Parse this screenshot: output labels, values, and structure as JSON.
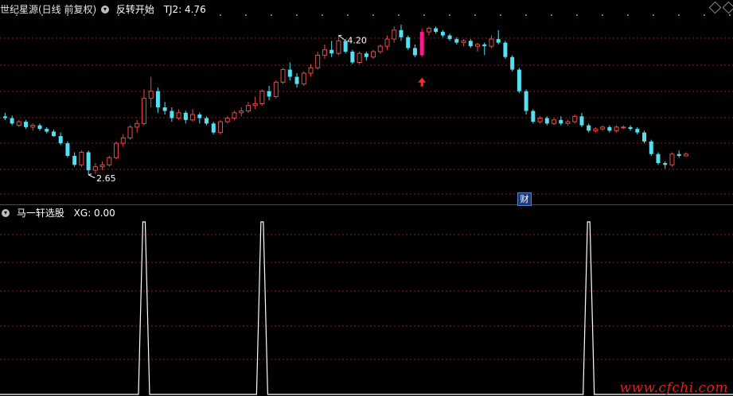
{
  "top_panel": {
    "ticker_label": "世纪星源(日线 前复权)",
    "indicator_name": "反转开始",
    "tj_label": "TJ2: 4.76",
    "high_label": "4.20",
    "low_label": "2.65",
    "finance_badge": "财"
  },
  "bottom_panel": {
    "indicator_name": "马一轩选股",
    "xg_label": "XG: 0.00"
  },
  "watermark": "www.cfchi.com",
  "colors": {
    "background": "#000000",
    "up_candle": "#e84848",
    "down_candle": "#54e0f0",
    "signal_candle": "#ff1a8c",
    "signal_arrow": "#ff2a2a",
    "grid_dash": "#8a1f1f",
    "panel_divider": "#b02020",
    "dots": "#c040d0",
    "xg_line": "#ffffff"
  },
  "chart_data": [
    {
      "type": "candlestick",
      "title": "世纪星源(日线 前复权)",
      "ylim": [
        2.4,
        4.4
      ],
      "candles": [
        [
          3.3,
          3.34,
          3.26,
          3.28
        ],
        [
          3.28,
          3.31,
          3.2,
          3.22
        ],
        [
          3.2,
          3.26,
          3.18,
          3.24
        ],
        [
          3.24,
          3.26,
          3.16,
          3.18
        ],
        [
          3.18,
          3.22,
          3.14,
          3.2
        ],
        [
          3.2,
          3.22,
          3.14,
          3.16
        ],
        [
          3.16,
          3.18,
          3.11,
          3.13
        ],
        [
          3.13,
          3.15,
          3.07,
          3.08
        ],
        [
          3.08,
          3.12,
          2.98,
          3.0
        ],
        [
          3.0,
          3.02,
          2.84,
          2.86
        ],
        [
          2.86,
          2.9,
          2.74,
          2.76
        ],
        [
          2.76,
          2.92,
          2.74,
          2.9
        ],
        [
          2.9,
          2.92,
          2.65,
          2.7
        ],
        [
          2.7,
          2.78,
          2.66,
          2.74
        ],
        [
          2.74,
          2.8,
          2.7,
          2.76
        ],
        [
          2.76,
          2.86,
          2.74,
          2.84
        ],
        [
          2.84,
          3.02,
          2.82,
          3.0
        ],
        [
          3.0,
          3.1,
          2.96,
          3.06
        ],
        [
          3.06,
          3.2,
          3.04,
          3.18
        ],
        [
          3.18,
          3.26,
          3.12,
          3.22
        ],
        [
          3.22,
          3.6,
          3.2,
          3.5
        ],
        [
          3.5,
          3.74,
          3.4,
          3.58
        ],
        [
          3.58,
          3.62,
          3.34,
          3.4
        ],
        [
          3.4,
          3.46,
          3.32,
          3.36
        ],
        [
          3.36,
          3.4,
          3.24,
          3.28
        ],
        [
          3.28,
          3.38,
          3.26,
          3.34
        ],
        [
          3.34,
          3.36,
          3.22,
          3.26
        ],
        [
          3.26,
          3.38,
          3.24,
          3.32
        ],
        [
          3.32,
          3.34,
          3.22,
          3.28
        ],
        [
          3.28,
          3.3,
          3.2,
          3.22
        ],
        [
          3.22,
          3.24,
          3.1,
          3.12
        ],
        [
          3.12,
          3.26,
          3.1,
          3.24
        ],
        [
          3.24,
          3.3,
          3.22,
          3.28
        ],
        [
          3.28,
          3.36,
          3.26,
          3.34
        ],
        [
          3.34,
          3.4,
          3.3,
          3.36
        ],
        [
          3.36,
          3.46,
          3.34,
          3.42
        ],
        [
          3.42,
          3.52,
          3.38,
          3.44
        ],
        [
          3.44,
          3.6,
          3.42,
          3.58
        ],
        [
          3.58,
          3.64,
          3.48,
          3.52
        ],
        [
          3.52,
          3.7,
          3.5,
          3.68
        ],
        [
          3.68,
          3.84,
          3.66,
          3.82
        ],
        [
          3.82,
          3.9,
          3.7,
          3.74
        ],
        [
          3.74,
          3.78,
          3.62,
          3.66
        ],
        [
          3.66,
          3.8,
          3.64,
          3.78
        ],
        [
          3.78,
          3.88,
          3.74,
          3.84
        ],
        [
          3.84,
          4.02,
          3.82,
          3.98
        ],
        [
          3.98,
          4.1,
          3.94,
          4.04
        ],
        [
          4.04,
          4.14,
          3.96,
          4.0
        ],
        [
          4.0,
          4.2,
          3.98,
          4.14
        ],
        [
          4.14,
          4.16,
          4.0,
          4.02
        ],
        [
          4.02,
          4.04,
          3.88,
          3.9
        ],
        [
          3.9,
          4.02,
          3.88,
          4.0
        ],
        [
          4.0,
          4.02,
          3.92,
          3.96
        ],
        [
          3.96,
          4.04,
          3.94,
          4.02
        ],
        [
          4.02,
          4.1,
          4.0,
          4.08
        ],
        [
          4.08,
          4.2,
          4.04,
          4.16
        ],
        [
          4.16,
          4.3,
          4.12,
          4.26
        ],
        [
          4.26,
          4.32,
          4.14,
          4.18
        ],
        [
          4.18,
          4.2,
          4.04,
          4.06
        ],
        [
          4.06,
          4.1,
          3.96,
          3.98
        ],
        [
          3.98,
          4.28,
          3.96,
          4.24
        ],
        [
          4.24,
          4.3,
          4.2,
          4.28
        ],
        [
          4.28,
          4.3,
          4.22,
          4.24
        ],
        [
          4.24,
          4.26,
          4.18,
          4.2
        ],
        [
          4.2,
          4.22,
          4.14,
          4.16
        ],
        [
          4.16,
          4.18,
          4.1,
          4.12
        ],
        [
          4.12,
          4.16,
          4.08,
          4.14
        ],
        [
          4.14,
          4.16,
          4.06,
          4.08
        ],
        [
          4.08,
          4.12,
          4.02,
          4.1
        ],
        [
          4.1,
          4.12,
          3.98,
          4.08
        ],
        [
          4.08,
          4.2,
          4.06,
          4.16
        ],
        [
          4.16,
          4.26,
          4.1,
          4.12
        ],
        [
          4.12,
          4.14,
          3.94,
          3.96
        ],
        [
          3.96,
          3.98,
          3.8,
          3.82
        ],
        [
          3.82,
          3.84,
          3.56,
          3.58
        ],
        [
          3.58,
          3.6,
          3.32,
          3.36
        ],
        [
          3.36,
          3.38,
          3.22,
          3.24
        ],
        [
          3.24,
          3.3,
          3.22,
          3.28
        ],
        [
          3.28,
          3.3,
          3.2,
          3.22
        ],
        [
          3.22,
          3.28,
          3.2,
          3.26
        ],
        [
          3.26,
          3.3,
          3.2,
          3.22
        ],
        [
          3.22,
          3.26,
          3.2,
          3.24
        ],
        [
          3.24,
          3.32,
          3.22,
          3.3
        ],
        [
          3.3,
          3.34,
          3.18,
          3.2
        ],
        [
          3.2,
          3.22,
          3.12,
          3.14
        ],
        [
          3.14,
          3.18,
          3.12,
          3.16
        ],
        [
          3.16,
          3.2,
          3.14,
          3.18
        ],
        [
          3.18,
          3.2,
          3.12,
          3.14
        ],
        [
          3.14,
          3.2,
          3.12,
          3.18
        ],
        [
          3.18,
          3.2,
          3.16,
          3.18
        ],
        [
          3.18,
          3.2,
          3.14,
          3.16
        ],
        [
          3.16,
          3.18,
          3.1,
          3.12
        ],
        [
          3.12,
          3.14,
          3.0,
          3.02
        ],
        [
          3.02,
          3.04,
          2.86,
          2.88
        ],
        [
          2.88,
          2.9,
          2.76,
          2.78
        ],
        [
          2.78,
          2.8,
          2.72,
          2.76
        ],
        [
          2.76,
          2.9,
          2.74,
          2.88
        ],
        [
          2.88,
          2.92,
          2.84,
          2.86
        ],
        [
          2.86,
          2.9,
          2.86,
          2.88
        ]
      ],
      "signal_index": 60,
      "high_marker": {
        "index": 48,
        "value": 4.2
      },
      "low_marker": {
        "index": 12,
        "value": 2.65
      }
    },
    {
      "type": "line",
      "title": "马一轩选股",
      "series": [
        {
          "name": "XG",
          "spikes_at": [
            20,
            37,
            84
          ],
          "values_range": [
            0,
            1
          ]
        }
      ]
    }
  ]
}
